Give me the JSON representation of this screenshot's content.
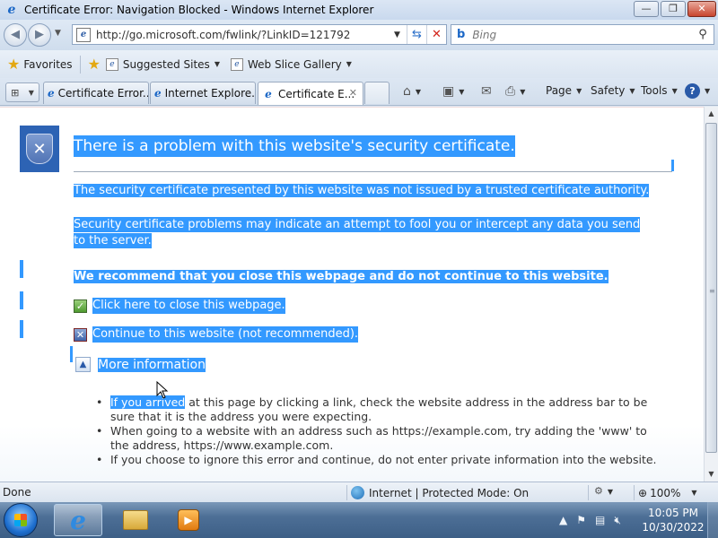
{
  "window": {
    "title": "Certificate Error: Navigation Blocked - Windows Internet Explorer",
    "buttons": {
      "minimize": "—",
      "maximize": "❐",
      "close": "✕"
    }
  },
  "nav": {
    "url": "http://go.microsoft.com/fwlink/?LinkID=121792",
    "search_placeholder": "Bing"
  },
  "favorites_bar": {
    "favorites_label": "Favorites",
    "links": [
      "Suggested Sites",
      "Web Slice Gallery"
    ]
  },
  "tabs": [
    {
      "label": "Certificate Error...",
      "active": false
    },
    {
      "label": "Internet Explore...",
      "active": false
    },
    {
      "label": "Certificate E...",
      "active": true
    }
  ],
  "command_bar": {
    "page": "Page",
    "safety": "Safety",
    "tools": "Tools"
  },
  "content": {
    "heading": "There is a problem with this website's security certificate.",
    "para1": "The security certificate presented by this website was not issued by a trusted certificate authority.",
    "para2": "Security certificate problems may indicate an attempt to fool you or intercept any data you send to the server.",
    "recommend": "We recommend that you close this webpage and do not continue to this website.",
    "close_link": "Click here to close this webpage.",
    "continue_link": "Continue to this website (not recommended).",
    "more_info": "More information",
    "bullets": [
      {
        "highlight": "If you arrived",
        "rest": " at this page by clicking a link, check the website address in the address bar to be sure that it is the address you were expecting."
      },
      {
        "highlight": "",
        "rest": "When going to a website with an address such as https://example.com, try adding the 'www' to the address, https://www.example.com."
      },
      {
        "highlight": "",
        "rest": "If you choose to ignore this error and continue, do not enter private information into the website."
      }
    ],
    "selection_color": "#3399ff"
  },
  "status": {
    "left": "Done",
    "zone": "Internet | Protected Mode: On",
    "zoom": "100%"
  },
  "taskbar": {
    "time": "10:05 PM",
    "date": "10/30/2022"
  }
}
